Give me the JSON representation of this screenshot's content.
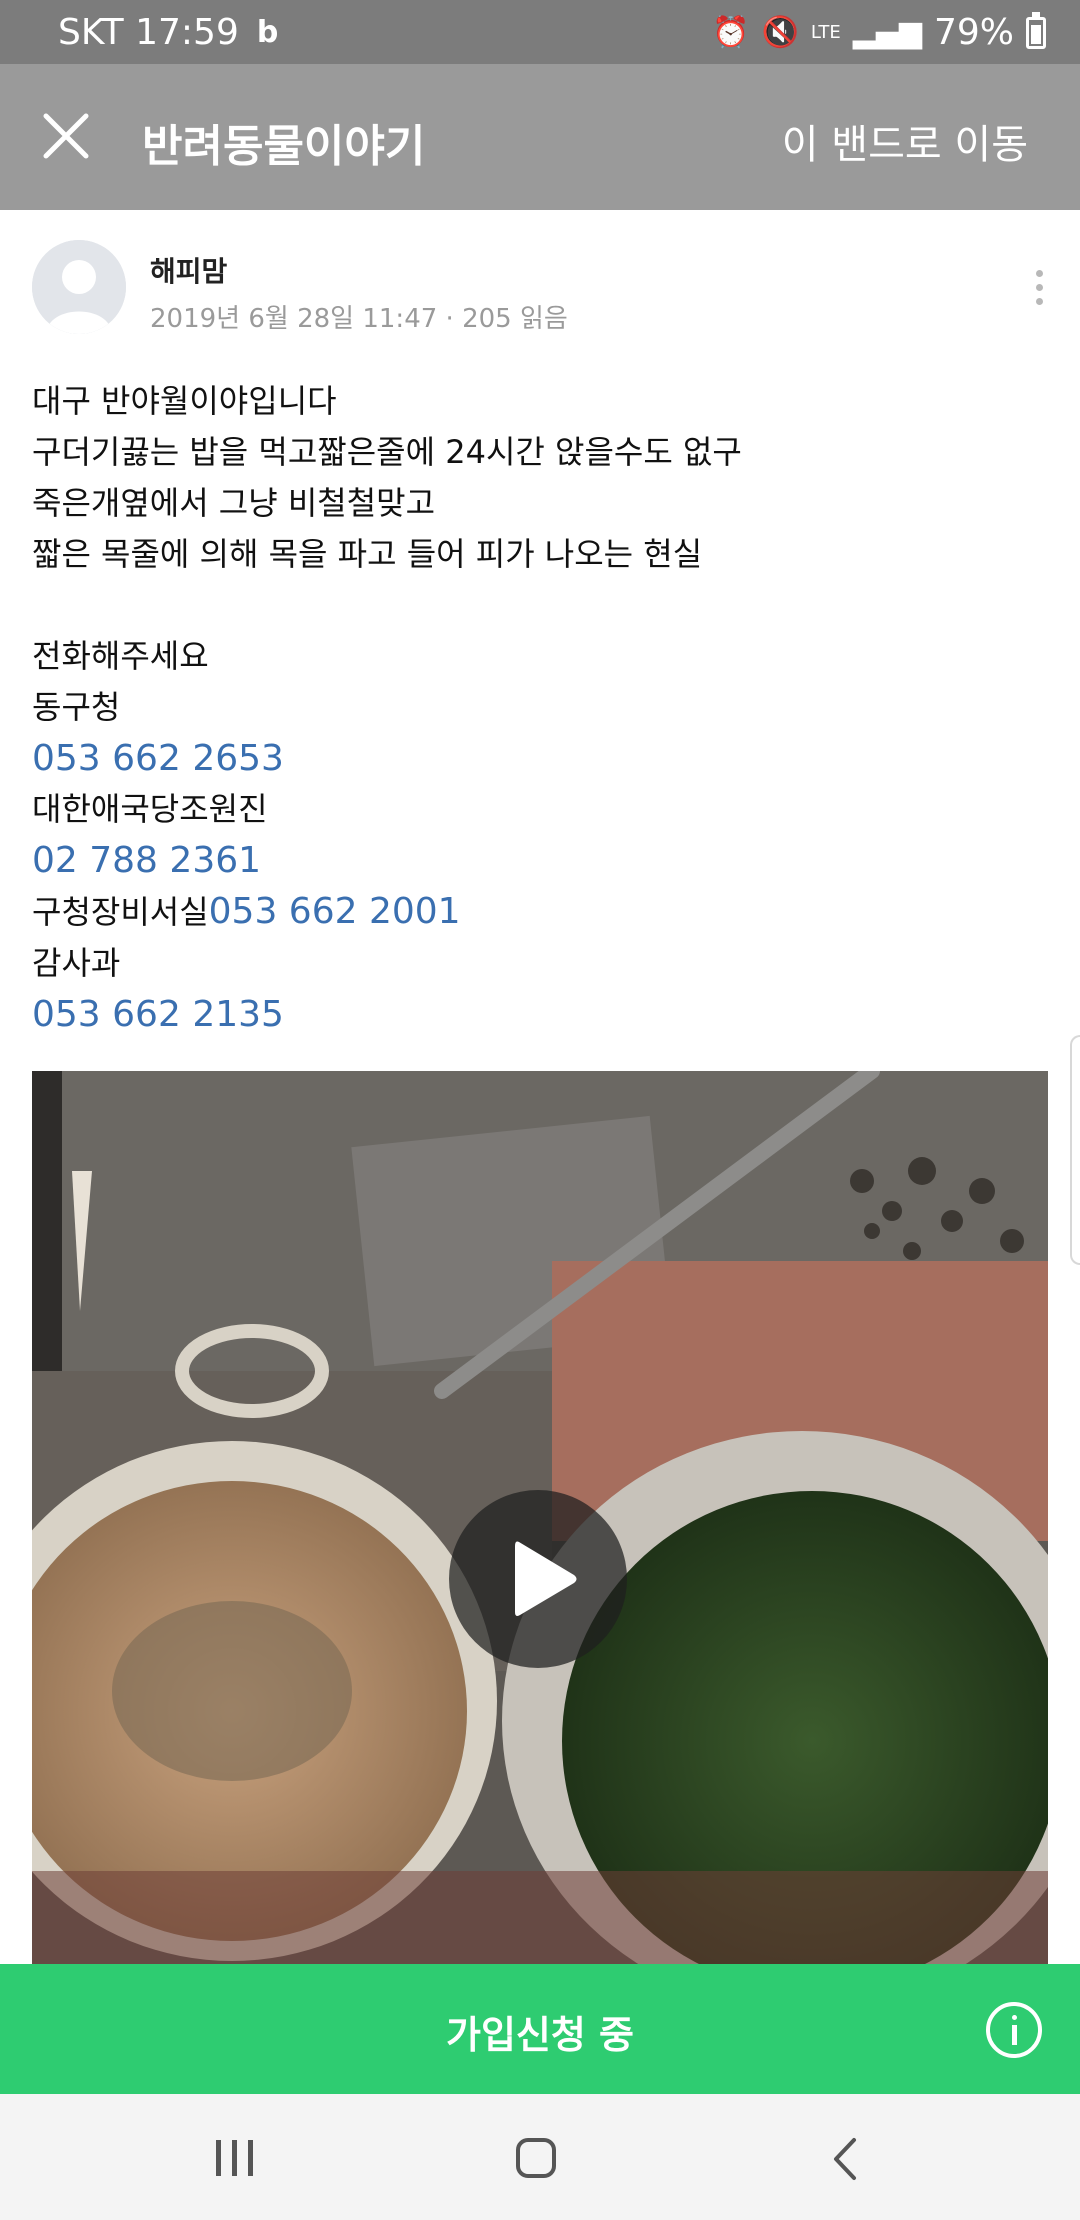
{
  "status_bar": {
    "carrier_time": "SKT 17:59",
    "band_app_icon": "b",
    "alarm_icon": "alarm-icon",
    "mute_icon": "mute-icon",
    "network": "LTE",
    "battery": "79%"
  },
  "app_bar": {
    "close_icon": "close-icon",
    "title": "반려동물이야기",
    "goto_band": "이 밴드로 이동"
  },
  "post": {
    "author": "해피맘",
    "meta": "2019년 6월 28일 11:47 · 205 읽음",
    "lines": [
      "대구 반야월이야입니다",
      "구더기끓는 밥을 먹고짧은줄에 24시간 앉을수도 없구",
      "죽은개옆에서 그냥 비철철맞고",
      "짧은 목줄에 의해 목을 파고 들어 피가 나오는 현실",
      "",
      "전화해주세요",
      "동구청"
    ],
    "phone1": "053 662 2653",
    "org2": "대한애국당조원진",
    "phone2": "02 788 2361",
    "org3": "구청장비서실",
    "phone3": "053 662 2001",
    "org4": "감사과",
    "phone4": "053 662 2135"
  },
  "video": {
    "play_icon": "play-icon"
  },
  "join_bar": {
    "label": "가입신청 중",
    "info_icon": "info-icon"
  },
  "nav_bar": {
    "recents_icon": "recents-icon",
    "home_icon": "home-icon",
    "back_icon": "back-icon"
  }
}
